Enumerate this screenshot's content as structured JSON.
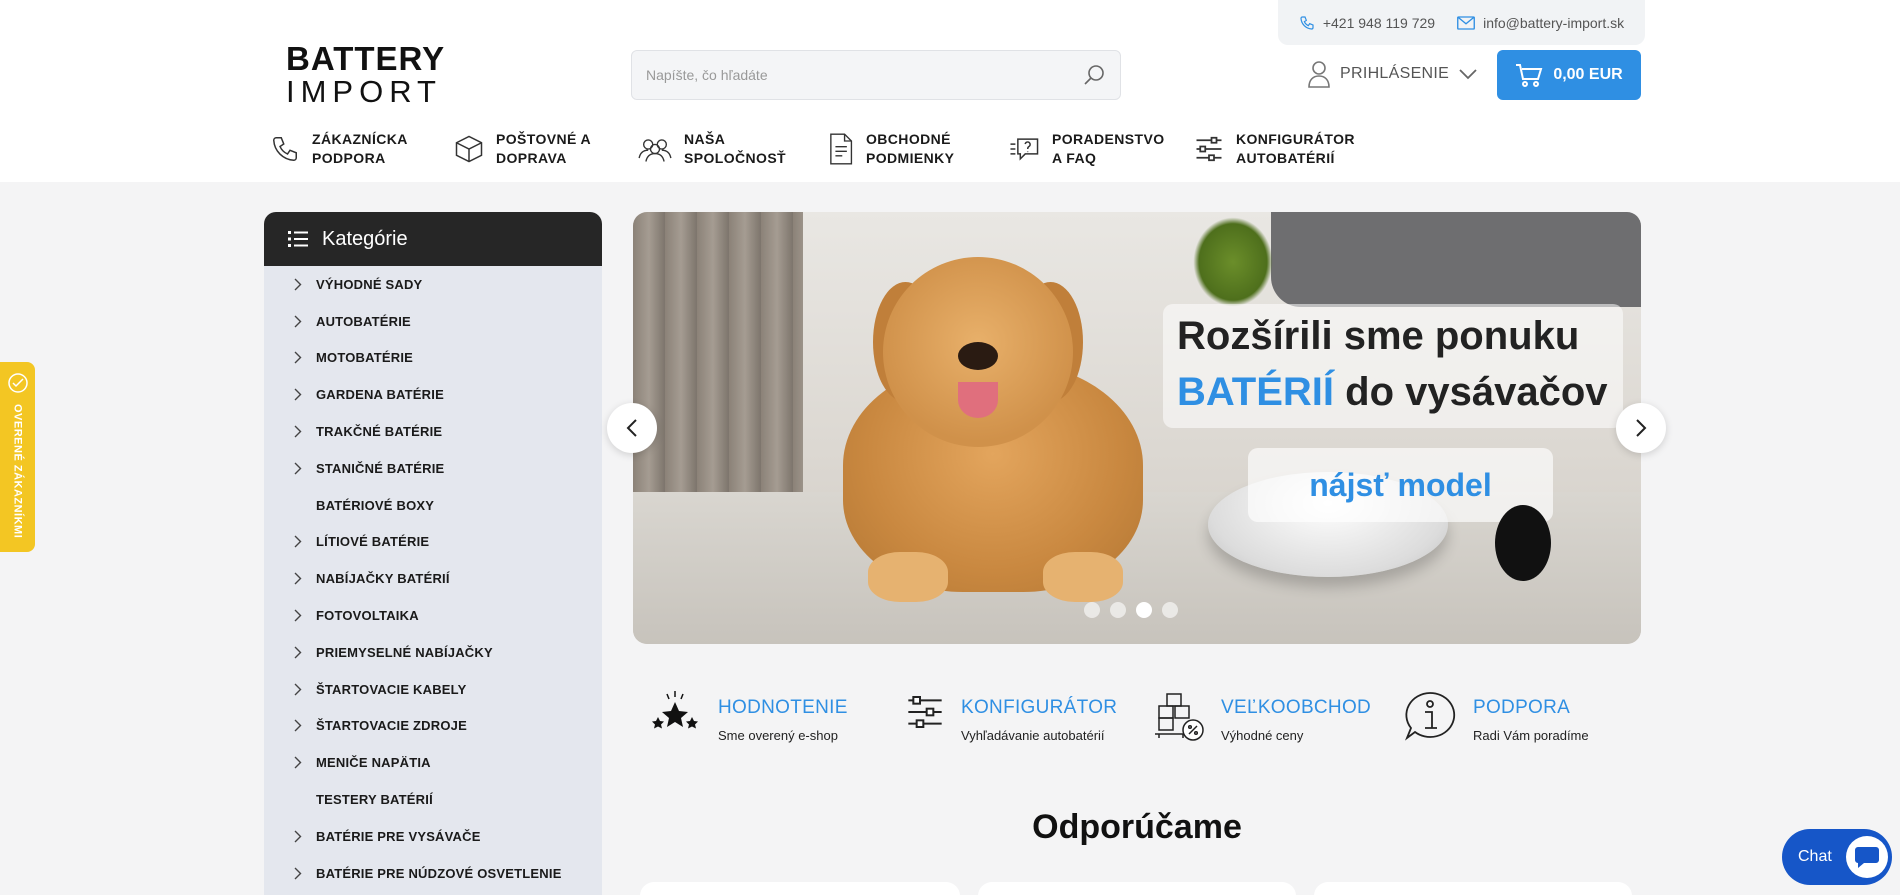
{
  "topbar": {
    "phone": "+421 948 119 729",
    "email": "info@battery-import.sk"
  },
  "logo": {
    "line1": "BATTERY",
    "line2": "IMPORT"
  },
  "search": {
    "placeholder": "Napíšte, čo hľadáte"
  },
  "login": {
    "label": "PRIHLÁSENIE"
  },
  "cart": {
    "label": "0,00 EUR"
  },
  "nav": [
    {
      "label": "ZÁKAZNÍCKA PODPORA",
      "icon": "phone-icon"
    },
    {
      "label": "POŠTOVNÉ A DOPRAVA",
      "icon": "box-icon"
    },
    {
      "label": "NAŠA SPOLOČNOSŤ",
      "icon": "people-icon"
    },
    {
      "label": "OBCHODNÉ PODMIENKY",
      "icon": "document-icon"
    },
    {
      "label": "PORADENSTVO A FAQ",
      "icon": "chat-question-icon"
    },
    {
      "label": "KONFIGURÁTOR AUTOBATÉRIÍ",
      "icon": "sliders-icon"
    }
  ],
  "categories": {
    "title": "Kategórie",
    "items": [
      {
        "label": "VÝHODNÉ SADY",
        "chevron": true
      },
      {
        "label": "AUTOBATÉRIE",
        "chevron": true
      },
      {
        "label": "MOTOBATÉRIE",
        "chevron": true
      },
      {
        "label": "GARDENA BATÉRIE",
        "chevron": true
      },
      {
        "label": "TRAKČNÉ BATÉRIE",
        "chevron": true
      },
      {
        "label": "STANIČNÉ BATÉRIE",
        "chevron": true
      },
      {
        "label": "BATÉRIOVÉ BOXY",
        "chevron": false
      },
      {
        "label": "LÍTIOVÉ BATÉRIE",
        "chevron": true
      },
      {
        "label": "NABÍJAČKY BATÉRIÍ",
        "chevron": true
      },
      {
        "label": "FOTOVOLTAIKA",
        "chevron": true
      },
      {
        "label": "PRIEMYSELNÉ NABÍJAČKY",
        "chevron": true
      },
      {
        "label": "ŠTARTOVACIE KABELY",
        "chevron": true
      },
      {
        "label": "ŠTARTOVACIE ZDROJE",
        "chevron": true
      },
      {
        "label": "MENIČE NAPÄTIA",
        "chevron": true
      },
      {
        "label": "TESTERY BATÉRIÍ",
        "chevron": false
      },
      {
        "label": "BATÉRIE PRE VYSÁVAČE",
        "chevron": true
      },
      {
        "label": "BATÉRIE PRE NÚDZOVÉ OSVETLENIE",
        "chevron": true
      }
    ]
  },
  "banner": {
    "line1": "Rozšírili sme ponuku",
    "line2_highlight": "BATÉRIÍ",
    "line2_rest": " do vysávačov",
    "button": "nájsť model",
    "slides": 4,
    "active_slide": 3
  },
  "features": [
    {
      "title": "HODNOTENIE",
      "subtitle": "Sme overený e-shop",
      "icon": "stars-icon"
    },
    {
      "title": "KONFIGURÁTOR",
      "subtitle": "Vyhľadávanie autobatérií",
      "icon": "sliders-icon"
    },
    {
      "title": "VEĽKOOBCHOD",
      "subtitle": "Výhodné ceny",
      "icon": "wholesale-icon"
    },
    {
      "title": "PODPORA",
      "subtitle": "Radi Vám poradíme",
      "icon": "info-bubble-icon"
    }
  ],
  "recommend": {
    "title": "Odporúčame"
  },
  "verified": {
    "label": "OVERENÉ ZÁKAZNÍKMI"
  },
  "chat": {
    "label": "Chat"
  },
  "colors": {
    "accent": "#2f8fe3",
    "dark": "#262626",
    "sidebar": "#e4e7ee",
    "badge": "#f3c623",
    "chat": "#1656c8"
  }
}
